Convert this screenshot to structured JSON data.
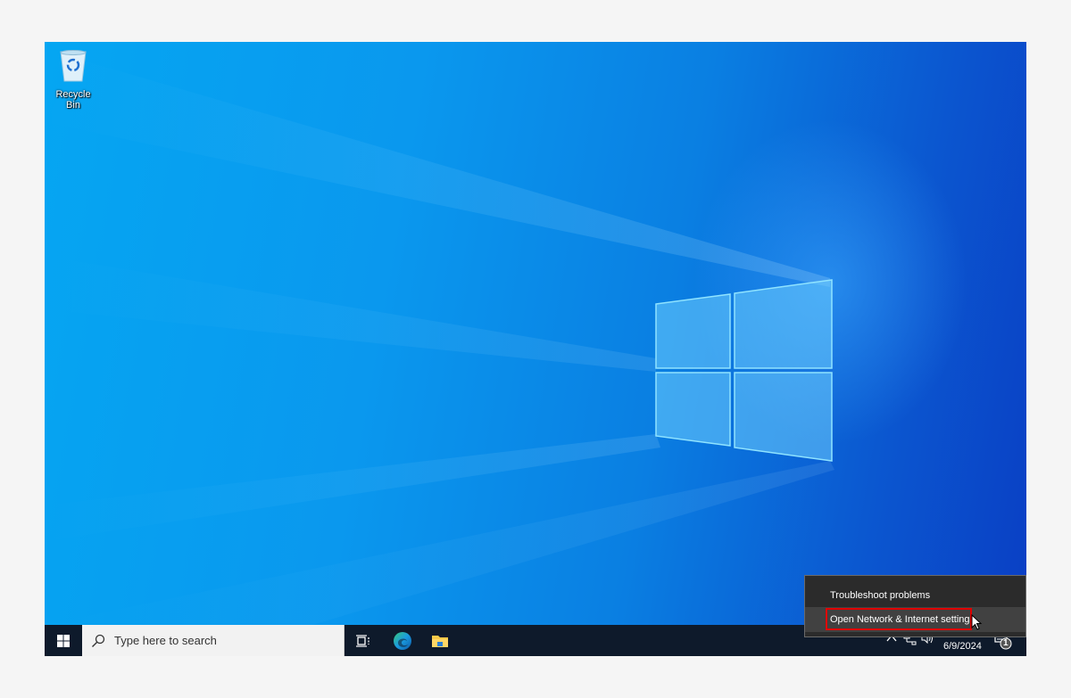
{
  "desktop": {
    "icons": [
      {
        "label": "Recycle Bin",
        "icon": "recycle-bin-icon"
      }
    ]
  },
  "taskbar": {
    "start_icon": "windows-start-icon",
    "search": {
      "placeholder": "Type here to search",
      "icon": "search-icon"
    },
    "pinned": [
      {
        "name": "Task View",
        "icon": "task-view-icon"
      },
      {
        "name": "Microsoft Edge",
        "icon": "edge-icon"
      },
      {
        "name": "File Explorer",
        "icon": "folder-icon"
      }
    ],
    "tray": {
      "icons": [
        "chevron-up-icon",
        "network-icon",
        "volume-icon"
      ],
      "date": "6/9/2024",
      "notifications_count": "1"
    }
  },
  "context_menu": {
    "items": [
      {
        "label": "Troubleshoot problems"
      },
      {
        "label": "Open Network & Internet settings",
        "hovered": true,
        "highlighted": true
      }
    ]
  },
  "colors": {
    "highlight_box": "#e00000",
    "taskbar": "#0e1a2b",
    "menu_bg": "#2b2b2b"
  }
}
